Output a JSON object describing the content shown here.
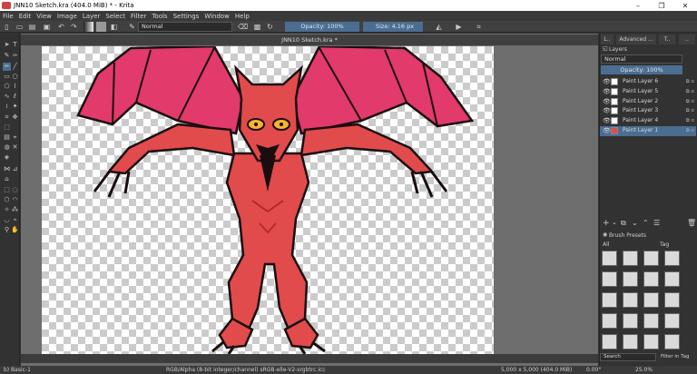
{
  "window": {
    "title": "JNN10 Sketch.kra (404.0 MiB) * - Krita",
    "minimize": "–",
    "maximize": "❐",
    "close": "✕"
  },
  "menu": [
    "File",
    "Edit",
    "View",
    "Image",
    "Layer",
    "Select",
    "Filter",
    "Tools",
    "Settings",
    "Window",
    "Help"
  ],
  "toolbar": {
    "blend_mode": "Normal",
    "opacity": "Opacity: 100%",
    "size": "Size: 4.16 px"
  },
  "document_tab": "JNN10 Sketch.kra *",
  "dock": {
    "tabs": [
      "L..",
      "Advanced ...",
      "T..",
      ".."
    ],
    "layers_title": "Layers",
    "blend_mode": "Normal",
    "opacity": "Opacity:  100%",
    "layers": [
      {
        "name": "Paint Layer 6",
        "selected": false
      },
      {
        "name": "Paint Layer 5",
        "selected": false
      },
      {
        "name": "Paint Layer 2",
        "selected": false
      },
      {
        "name": "Paint Layer 3",
        "selected": false
      },
      {
        "name": "Paint Layer 4",
        "selected": false
      },
      {
        "name": "Paint Layer 1",
        "selected": true
      }
    ],
    "brush_presets_title": "Brush Presets",
    "brush_filter": "All",
    "brush_tag": "Tag",
    "search_placeholder": "Search",
    "filter_in_tag": "Filter in Tag"
  },
  "status": {
    "brush": "b) Basic-1",
    "color_info": "RGB/Alpha (8-bit integer/channel)  sRGB-elle-V2-srgbtrc.icc",
    "dimensions": "5,000 x 5,000 (404.0 MiB)",
    "rotation": "0.00°",
    "zoom": "25.0%"
  },
  "colors": {
    "accent": "#4b6d92",
    "demon_red": "#e24b4b",
    "demon_dark": "#b32b2b",
    "wing_pink": "#e23a6a"
  }
}
